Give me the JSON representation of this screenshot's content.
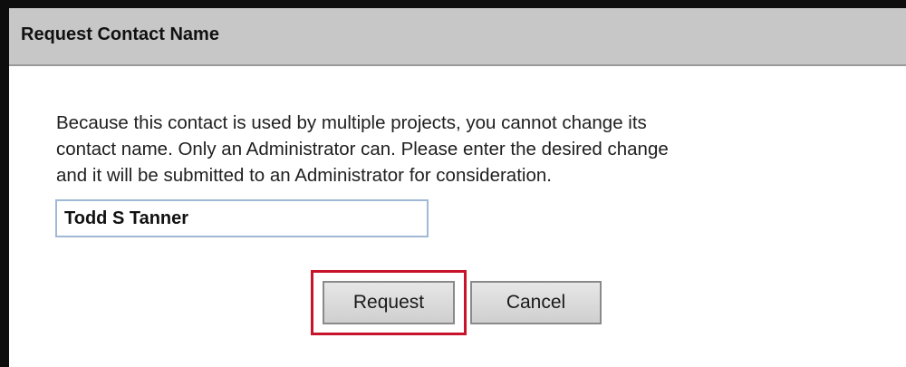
{
  "dialog": {
    "title": "Request Contact Name",
    "message_lines": [
      "Because this contact is used by multiple projects, you cannot change its",
      "contact name. Only an Administrator can. Please enter the desired change",
      "and it will be submitted to an Administrator for consideration."
    ],
    "contact_name_value": "Todd S Tanner",
    "buttons": {
      "request": "Request",
      "cancel": "Cancel"
    }
  },
  "colors": {
    "title_bar": "#c7c7c7",
    "highlight": "#c8142a",
    "input_border": "#9fb9d6",
    "window_border": "#0d0d0d"
  }
}
